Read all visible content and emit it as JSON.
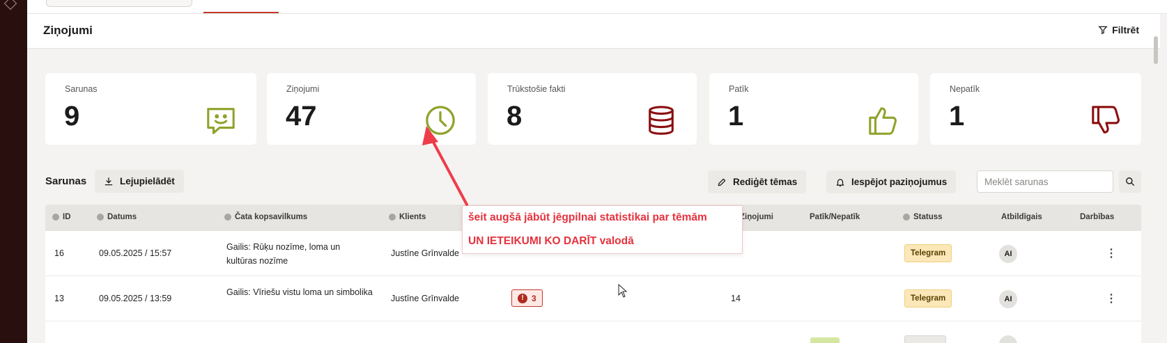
{
  "page": {
    "title": "Ziņojumi",
    "filter_label": "Filtrēt"
  },
  "stats": [
    {
      "label": "Sarunas",
      "value": "9",
      "icon": "chat-smile-icon",
      "color": "#8ea32b"
    },
    {
      "label": "Ziņojumi",
      "value": "47",
      "icon": "clock-icon",
      "color": "#8ea32b"
    },
    {
      "label": "Trūkstošie fakti",
      "value": "8",
      "icon": "database-icon",
      "color": "#8b0f0f"
    },
    {
      "label": "Patīk",
      "value": "1",
      "icon": "thumbs-up-icon",
      "color": "#8ea32b"
    },
    {
      "label": "Nepatīk",
      "value": "1",
      "icon": "thumbs-down-icon",
      "color": "#8b0f0f"
    }
  ],
  "section": {
    "title": "Sarunas",
    "download_label": "Lejupielādēt",
    "edit_topics_label": "Rediģēt tēmas",
    "notifications_label": "Iespējot paziņojumus",
    "search_placeholder": "Meklēt sarunas"
  },
  "table": {
    "headers": {
      "id": "ID",
      "date": "Datums",
      "summary": "Čata kopsavilkums",
      "client": "Klients",
      "messages": "Ziņojumi",
      "likes": "Patīk/Nepatīk",
      "status": "Statuss",
      "owner": "Atbildīgais",
      "actions": "Darbības"
    },
    "rows": [
      {
        "id": "16",
        "date": "09.05.2025 / 15:57",
        "summary": "Gailis: Rūķu nozīme, loma un kultūras nozīme",
        "client": "Justīne Grīnvalde",
        "errors": "",
        "messages": "",
        "status": "Telegram",
        "owner": "AI"
      },
      {
        "id": "13",
        "date": "09.05.2025 / 13:59",
        "summary": "Gailis: Vīriešu vistu loma un simbolika",
        "client": "Justīne Grīnvalde",
        "errors": "3",
        "messages": "14",
        "status": "Telegram",
        "owner": "AI"
      }
    ]
  },
  "annotation": {
    "line1": "šeit augšā jābūt jēgpilnai statistikai par tēmām",
    "line2": "UN IETEIKUMI KO DARĪT valodā"
  },
  "colors": {
    "accent": "#c0392b",
    "annotation": "#e5323d",
    "green": "#8ea32b",
    "darkred": "#8b0f0f"
  }
}
